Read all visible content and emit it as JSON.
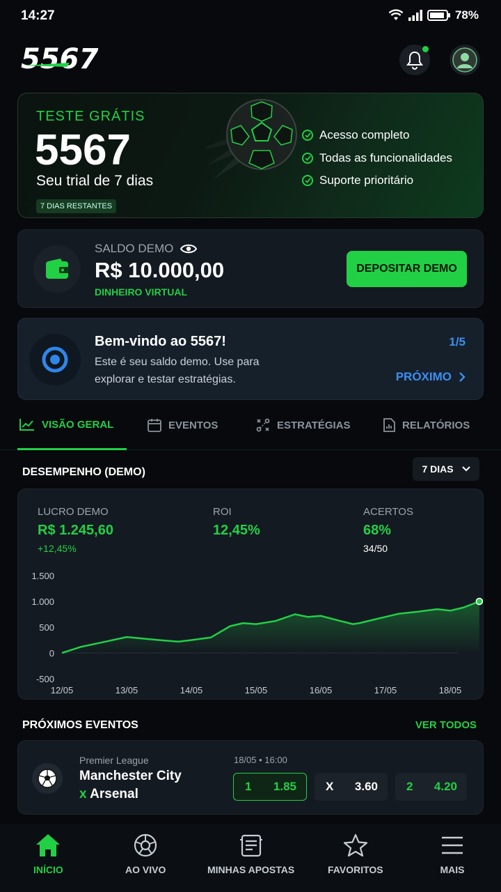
{
  "status_bar": {
    "time": "14:27",
    "battery": "78%"
  },
  "header": {
    "logo": "5567"
  },
  "trial": {
    "label": "TESTE GRÁTIS",
    "big": "5567",
    "subtitle": "Seu trial de 7 dias",
    "badge": "7 DIAS RESTANTES",
    "features": [
      "Acesso completo",
      "Todas as funcionalidades",
      "Suporte prioritário"
    ]
  },
  "saldo": {
    "label": "SALDO DEMO",
    "value": "R$ 10.000,00",
    "sub": "DINHEIRO VIRTUAL",
    "button": "DEPOSITAR DEMO"
  },
  "welcome": {
    "title": "Bem-vindo ao 5567!",
    "text": "Este é seu saldo demo. Use para explorar e testar estratégias.",
    "page": "1/5",
    "next": "PRÓXIMO"
  },
  "tabs": [
    {
      "label": "VISÃO GERAL",
      "icon": "chart-line-icon",
      "active": true
    },
    {
      "label": "EVENTOS",
      "icon": "calendar-icon",
      "active": false
    },
    {
      "label": "ESTRATÉGIAS",
      "icon": "strategy-icon",
      "active": false
    },
    {
      "label": "RELATÓRIOS",
      "icon": "report-icon",
      "active": false
    }
  ],
  "performance": {
    "title": "DESEMPENHO (DEMO)",
    "period": "7 DIAS",
    "metrics": [
      {
        "label": "LUCRO DEMO",
        "value": "R$ 1.245,60",
        "sub": "+12,45%"
      },
      {
        "label": "ROI",
        "value": "12,45%",
        "sub": ""
      },
      {
        "label": "ACERTOS",
        "value": "68%",
        "sub": "34/50"
      }
    ]
  },
  "chart_data": {
    "type": "area",
    "x_labels": [
      "12/05",
      "13/05",
      "14/05",
      "15/05",
      "16/05",
      "17/05",
      "18/05"
    ],
    "y_ticks": [
      "1.500",
      "1.000",
      "500",
      "0",
      "-500"
    ],
    "ylim": [
      -500,
      1500
    ],
    "x": [
      0,
      0.3,
      0.6,
      1,
      1.5,
      1.8,
      2,
      2.3,
      2.6,
      2.8,
      3,
      3.3,
      3.6,
      3.8,
      4,
      4.3,
      4.5,
      4.6,
      4.8,
      5,
      5.2,
      5.5,
      5.8,
      6,
      6.2,
      6.45
    ],
    "values": [
      0,
      120,
      200,
      310,
      250,
      220,
      250,
      300,
      520,
      580,
      560,
      620,
      750,
      700,
      720,
      620,
      560,
      580,
      640,
      700,
      760,
      800,
      850,
      820,
      880,
      1000
    ],
    "color": "#22d046"
  },
  "events": {
    "title": "PRÓXIMOS EVENTOS",
    "see_all": "VER TODOS",
    "items": [
      {
        "league": "Premier League",
        "home": "Manchester City",
        "away_prefix": "x",
        "away": "Arsenal",
        "time": "18/05 • 16:00",
        "odds": [
          {
            "label": "1",
            "value": "1.85"
          },
          {
            "label": "X",
            "value": "3.60"
          },
          {
            "label": "2",
            "value": "4.20"
          }
        ]
      }
    ]
  },
  "bottom_nav": [
    {
      "label": "INÍCIO",
      "icon": "home-icon"
    },
    {
      "label": "AO VIVO",
      "icon": "live-icon"
    },
    {
      "label": "MINHAS APOSTAS",
      "icon": "bets-icon"
    },
    {
      "label": "FAVORITOS",
      "icon": "star-icon"
    },
    {
      "label": "MAIS",
      "icon": "menu-icon"
    }
  ]
}
